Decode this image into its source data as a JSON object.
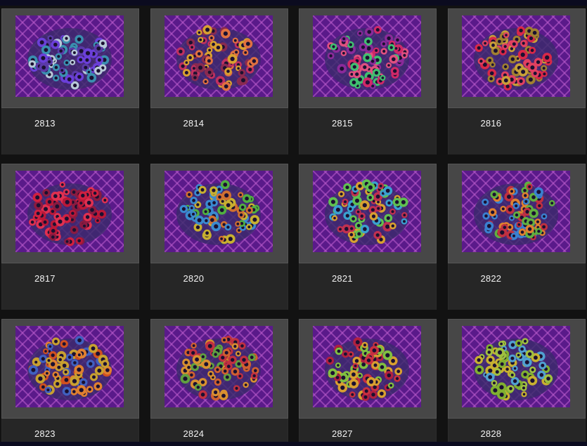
{
  "products": [
    {
      "sku": "2813",
      "palette": [
        "#6b3fd9",
        "#3a8fb0",
        "#b8c9d8",
        "#5a3aa8"
      ]
    },
    {
      "sku": "2814",
      "palette": [
        "#c03060",
        "#d8a030",
        "#8a2a50",
        "#e07040"
      ]
    },
    {
      "sku": "2815",
      "palette": [
        "#d02868",
        "#40c070",
        "#e05080",
        "#8a2a9a"
      ]
    },
    {
      "sku": "2816",
      "palette": [
        "#c8a038",
        "#d82848",
        "#a08030",
        "#e04060"
      ]
    },
    {
      "sku": "2817",
      "palette": [
        "#d02040",
        "#b81838",
        "#e03050",
        "#8a1a40"
      ]
    },
    {
      "sku": "2820",
      "palette": [
        "#50b040",
        "#c8b030",
        "#3a8ad0",
        "#d07030"
      ]
    },
    {
      "sku": "2821",
      "palette": [
        "#d8a030",
        "#c03050",
        "#3aa0d0",
        "#60c050"
      ]
    },
    {
      "sku": "2822",
      "palette": [
        "#e08030",
        "#c03040",
        "#60b040",
        "#3a80d0"
      ]
    },
    {
      "sku": "2823",
      "palette": [
        "#e08030",
        "#d05020",
        "#c8a030",
        "#4060c0"
      ]
    },
    {
      "sku": "2824",
      "palette": [
        "#d06030",
        "#c03040",
        "#60a040",
        "#d89030"
      ]
    },
    {
      "sku": "2827",
      "palette": [
        "#c83040",
        "#80c040",
        "#d8a030",
        "#b02040"
      ]
    },
    {
      "sku": "2828",
      "palette": [
        "#a0c040",
        "#c8b030",
        "#50a0d0",
        "#80b030"
      ]
    }
  ],
  "colors": {
    "background": "#121212",
    "card": "#242424",
    "frame": "#474747",
    "tank_bg": "#5a1a8a",
    "grid_line": "#c060d0",
    "accent_bar": "#0b0b1f"
  }
}
